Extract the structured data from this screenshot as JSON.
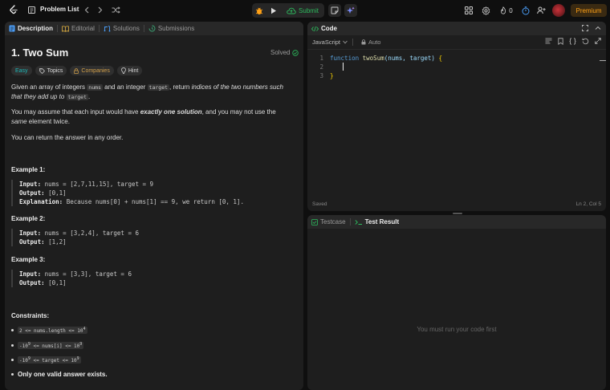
{
  "topbar": {
    "problem_list_label": "Problem List",
    "submit_label": "Submit",
    "streak_count": "0",
    "premium_label": "Premium"
  },
  "left_panel": {
    "tabs": [
      {
        "label": "Description",
        "icon": "description-icon",
        "active": true
      },
      {
        "label": "Editorial",
        "icon": "editorial-icon",
        "active": false
      },
      {
        "label": "Solutions",
        "icon": "solutions-icon",
        "active": false
      },
      {
        "label": "Submissions",
        "icon": "submissions-icon",
        "active": false
      }
    ]
  },
  "problem": {
    "title": "1. Two Sum",
    "status": "Solved",
    "tags": {
      "difficulty": "Easy",
      "topics": "Topics",
      "companies": "Companies",
      "hint": "Hint"
    },
    "statement": {
      "p1_a": "Given an array of integers ",
      "p1_code1": "nums",
      "p1_b": " and an integer ",
      "p1_code2": "target",
      "p1_c": ", return ",
      "p1_em": "indices of the two numbers such that they add up to",
      "p1_code3": "target",
      "p1_d": ".",
      "p2_a": "You may assume that each input would have ",
      "p2_strong": "exactly one solution",
      "p2_b": ", and you may not use the ",
      "p2_em": "same",
      "p2_c": " element twice.",
      "p3": "You can return the answer in any order."
    },
    "examples": [
      {
        "heading": "Example 1:",
        "input_label": "Input:",
        "input": " nums = [2,7,11,15], target = 9",
        "output_label": "Output:",
        "output": " [0,1]",
        "explanation_label": "Explanation:",
        "explanation": " Because nums[0] + nums[1] == 9, we return [0, 1]."
      },
      {
        "heading": "Example 2:",
        "input_label": "Input:",
        "input": " nums = [3,2,4], target = 6",
        "output_label": "Output:",
        "output": " [1,2]"
      },
      {
        "heading": "Example 3:",
        "input_label": "Input:",
        "input": " nums = [3,3], target = 6",
        "output_label": "Output:",
        "output": " [0,1]"
      }
    ],
    "constraints_heading": "Constraints:",
    "constraints": [
      {
        "base": "2 <= nums.length <= 10",
        "sup": "4"
      },
      {
        "pre": "-10",
        "pre_sup": "9",
        "base": " <= nums[i] <= 10",
        "sup": "9"
      },
      {
        "pre": "-10",
        "pre_sup": "9",
        "base": " <= target <= 10",
        "sup": "9"
      }
    ],
    "constraint_final": "Only one valid answer exists."
  },
  "code_panel": {
    "title": "Code",
    "language": "JavaScript",
    "mode": "Auto",
    "lines": [
      {
        "n": "1",
        "kw": "function",
        "fn": "twoSum",
        "params": "(nums, target)",
        "brace": "{"
      },
      {
        "n": "2"
      },
      {
        "n": "3",
        "brace": "}"
      }
    ],
    "status_left": "Saved",
    "status_right": "Ln 2, Col 5"
  },
  "result_panel": {
    "tabs": [
      {
        "label": "Testcase",
        "active": false
      },
      {
        "label": "Test Result",
        "active": true
      }
    ],
    "empty_message": "You must run your code first"
  },
  "colors": {
    "accent_green": "#2cbb5d",
    "easy": "#1cb8b8",
    "premium": "#ffa116"
  }
}
